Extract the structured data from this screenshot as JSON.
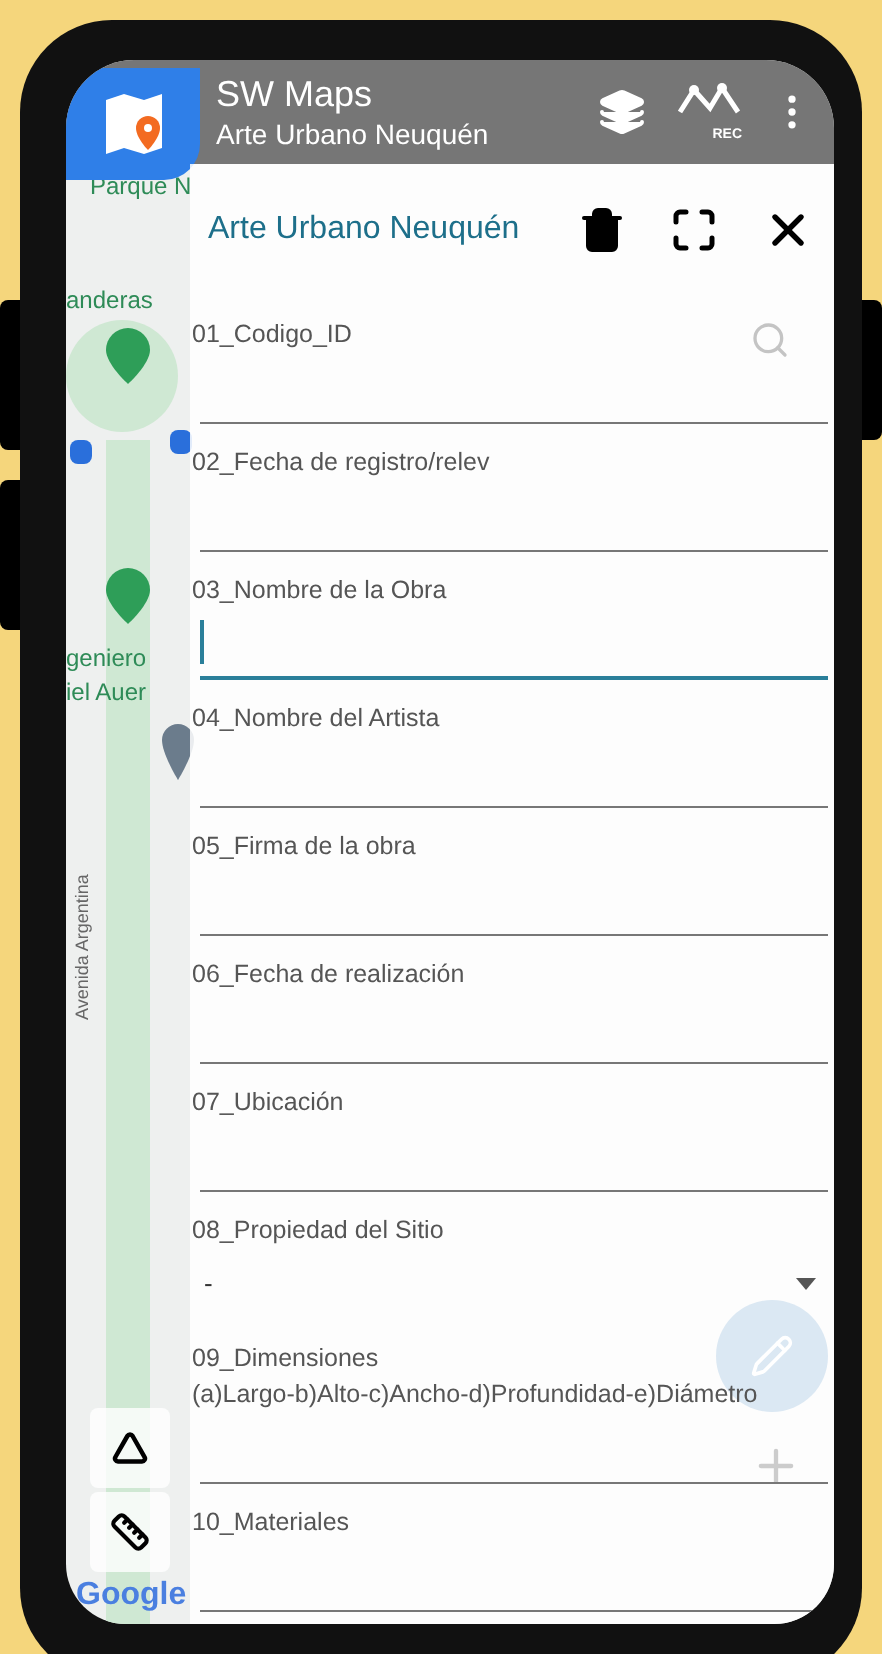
{
  "app_bar": {
    "title": "SW Maps",
    "subtitle": "Arte Urbano Neuquén",
    "rec_label": "REC"
  },
  "map": {
    "labels": [
      {
        "text": "Parque N",
        "kind": "park"
      },
      {
        "text": "anderas",
        "kind": "park"
      },
      {
        "text": "geniero",
        "kind": "park"
      },
      {
        "text": "iel Auer",
        "kind": "park"
      },
      {
        "text": "Avenida Argentina",
        "kind": "street"
      }
    ],
    "attribution": "Google"
  },
  "form": {
    "title": "Arte Urbano Neuquén",
    "fields": [
      {
        "label": "01_Codigo_ID",
        "kind": "text",
        "focused": false
      },
      {
        "label": "02_Fecha de registro/relev",
        "kind": "text",
        "focused": false
      },
      {
        "label": "03_Nombre de la Obra",
        "kind": "text",
        "focused": true
      },
      {
        "label": "04_Nombre del Artista",
        "kind": "text",
        "focused": false
      },
      {
        "label": "05_Firma de la obra",
        "kind": "text",
        "focused": false
      },
      {
        "label": "06_Fecha de realización",
        "kind": "text",
        "focused": false
      },
      {
        "label": "07_Ubicación",
        "kind": "text",
        "focused": false
      },
      {
        "label": "08_Propiedad del Sitio",
        "kind": "dropdown",
        "value": "-",
        "focused": false
      },
      {
        "label": "09_Dimensiones\n(a)Largo-b)Alto-c)Ancho-d)Profundidad-e)Diámetro",
        "kind": "text",
        "focused": false
      },
      {
        "label": "10_Materiales",
        "kind": "text",
        "focused": false
      }
    ]
  }
}
